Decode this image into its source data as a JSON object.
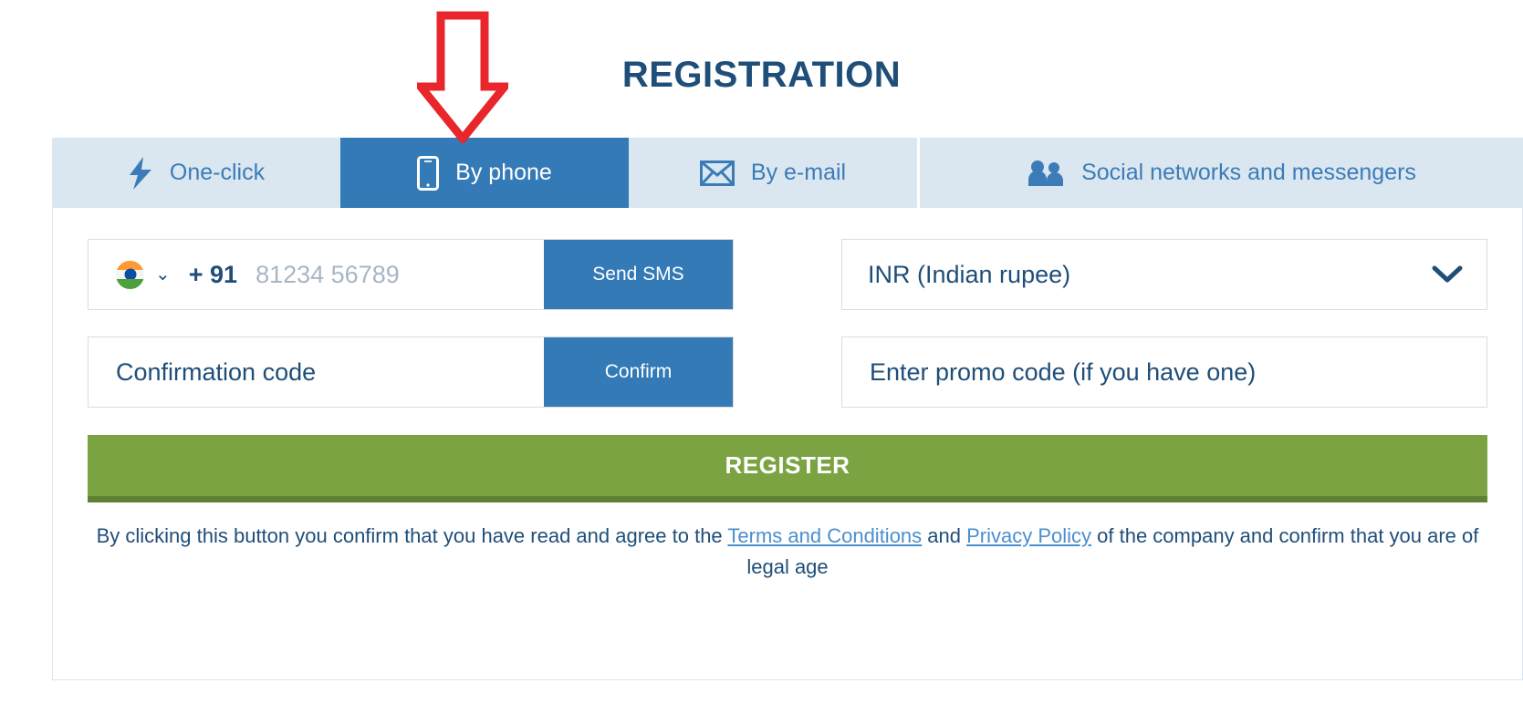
{
  "page": {
    "title": "REGISTRATION"
  },
  "annotation": {
    "arrow_icon": "red-down-arrow",
    "arrow_color": "#e8262b",
    "points_at": "By phone"
  },
  "tabs": {
    "items": [
      {
        "id": "one-click",
        "label": "One-click",
        "icon": "lightning-bolt-icon",
        "active": false
      },
      {
        "id": "by-phone",
        "label": "By phone",
        "icon": "mobile-phone-icon",
        "active": true
      },
      {
        "id": "by-email",
        "label": "By e-mail",
        "icon": "envelope-icon",
        "active": false
      },
      {
        "id": "social",
        "label": "Social networks and messengers",
        "icon": "people-group-icon",
        "active": false
      }
    ],
    "active_color": "#337ab7",
    "inactive_background": "#dae7f0",
    "inactive_text_color": "#3b7cb8"
  },
  "form": {
    "phone": {
      "country_flag_icon": "india-flag-icon",
      "country_chevron_icon": "chevron-down-icon",
      "dial_code": "+ 91",
      "placeholder": "81234 56789",
      "value": "",
      "send_button_label": "Send SMS"
    },
    "currency": {
      "label": "INR (Indian rupee)",
      "chevron_icon": "chevron-down-icon",
      "options": [
        "INR (Indian rupee)"
      ]
    },
    "confirmation": {
      "placeholder": "Confirmation code",
      "value": "",
      "confirm_button_label": "Confirm"
    },
    "promo": {
      "placeholder": "Enter promo code (if you have one)",
      "value": ""
    },
    "register_button": {
      "label": "REGISTER",
      "color": "#7ba342",
      "shadow_color": "#5f8133"
    }
  },
  "disclaimer": {
    "text_before": "By clicking this button you confirm that you have read and agree to the ",
    "terms_link": "Terms and Conditions",
    "text_between": " and ",
    "privacy_link": "Privacy Policy",
    "text_after": " of the company and confirm that you are of legal age",
    "link_color": "#4a8fd0"
  }
}
